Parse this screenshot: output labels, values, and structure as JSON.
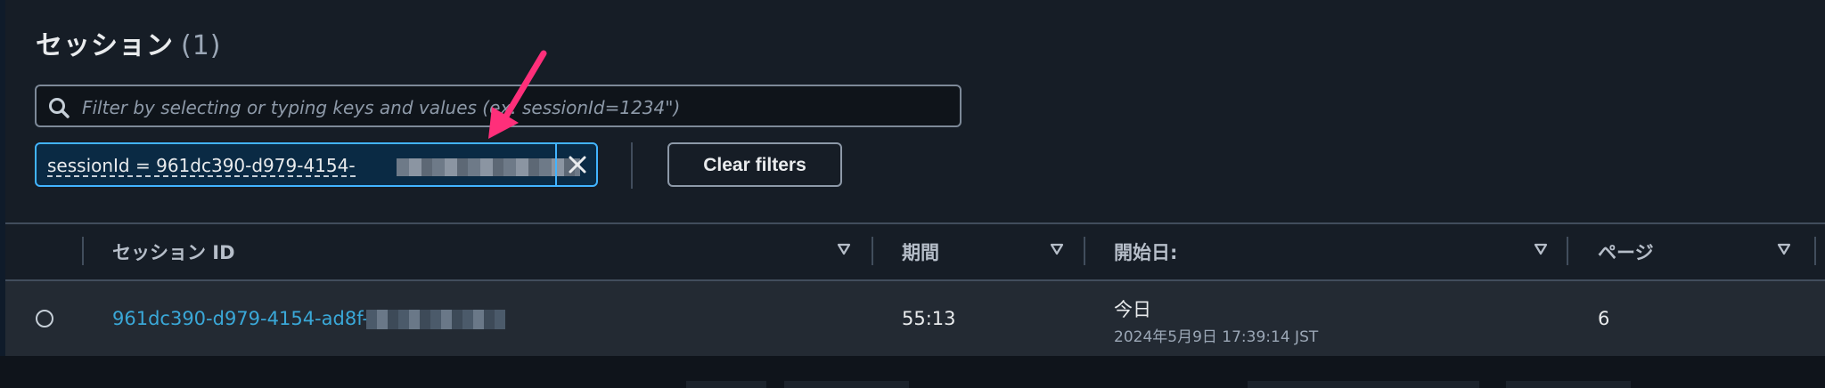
{
  "header": {
    "title": "セッション",
    "count": "(1)"
  },
  "filter": {
    "placeholder": "Filter by selecting or typing keys and values (ex. sessionId=1234\")",
    "token_label": "sessionId = 961dc390-d979-4154-",
    "clear_label": "Clear filters"
  },
  "table": {
    "columns": [
      "セッション ID",
      "期間",
      "開始日:",
      "ページ"
    ],
    "rows": [
      {
        "session_id": "961dc390-d979-4154-ad8f-",
        "duration": "55:13",
        "start_day": "今日",
        "start_datetime": "2024年5月9日 17:39:14 JST",
        "pages": "6"
      }
    ]
  },
  "colors": {
    "accent": "#42b4ff",
    "link": "#3aa8d8",
    "annotation": "#ff2f7a"
  }
}
